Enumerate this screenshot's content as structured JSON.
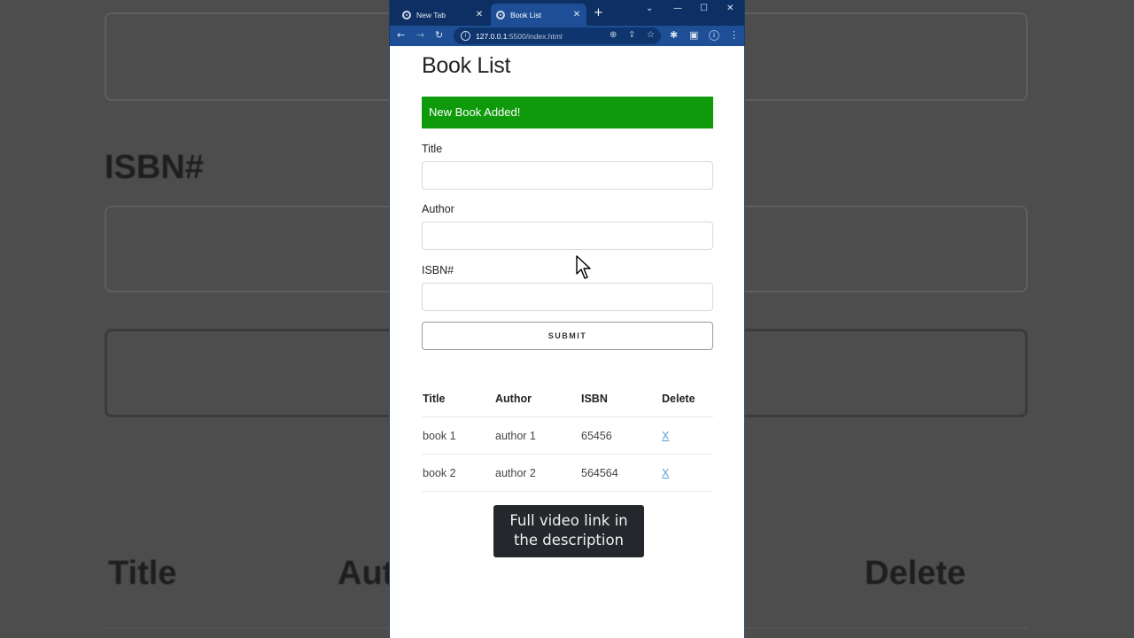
{
  "background": {
    "isbn_heading": "ISBN#",
    "col_title": "Title",
    "col_author_partial": "Aut",
    "col_delete": "Delete"
  },
  "browser": {
    "tabs": [
      {
        "label": "New Tab",
        "active": false
      },
      {
        "label": "Book List",
        "active": true
      }
    ],
    "new_tab_symbol": "+",
    "url_host": "127.0.0.1",
    "url_rest": ":5500/index.html"
  },
  "page": {
    "title": "Book List",
    "alert": "New Book Added!",
    "form": {
      "title_label": "Title",
      "title_value": "",
      "author_label": "Author",
      "author_value": "",
      "isbn_label": "ISBN#",
      "isbn_value": "",
      "submit_label": "SUBMIT"
    },
    "table": {
      "headers": [
        "Title",
        "Author",
        "ISBN",
        "Delete"
      ],
      "rows": [
        {
          "title": "book 1",
          "author": "author 1",
          "isbn": "65456",
          "delete": "X"
        },
        {
          "title": "book 2",
          "author": "author 2",
          "isbn": "564564",
          "delete": "X"
        }
      ]
    }
  },
  "overlay": {
    "tooltip_line1": "Full video link in",
    "tooltip_line2": "the description"
  },
  "colors": {
    "alert_green": "#0f9a0b",
    "browser_blue": "#1e4f96",
    "tabstrip_navy": "#0d2f63",
    "link_blue": "#5aa0d6"
  }
}
